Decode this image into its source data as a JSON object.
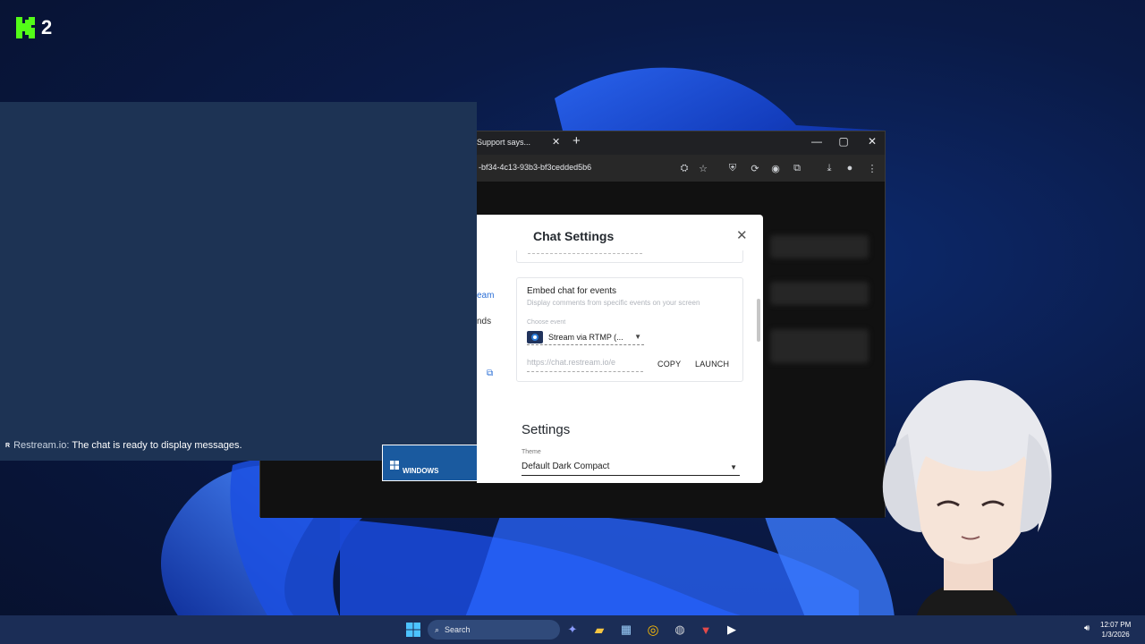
{
  "logo": {
    "mark": "K",
    "number": "2"
  },
  "chat_overlay": {
    "sender": "Restream.io:",
    "message": "The chat is ready to display messages."
  },
  "browser": {
    "tab_title": "Support says...",
    "tab_close": "✕",
    "new_tab": "+",
    "url": "-bf34-4c13-93b3-bf3cedded5b6",
    "window_buttons": {
      "minimize": "—",
      "maximize": "▢",
      "close": "✕"
    }
  },
  "modal": {
    "title": "Chat Settings",
    "close": "✕",
    "side_links": [
      "eam",
      "nds"
    ],
    "embed_card": {
      "title": "Embed chat for events",
      "subtitle": "Display comments from specific events on your screen",
      "choose_label": "Choose event",
      "selected_event": "Stream via RTMP (...",
      "url_value": "https://chat.restream.io/e",
      "copy_label": "COPY",
      "launch_label": "LAUNCH"
    },
    "settings_heading": "Settings",
    "theme_label": "Theme",
    "theme_value": "Default Dark Compact"
  },
  "windows_button": {
    "label": "WINDOWS"
  },
  "taskbar": {
    "search_label": "Search",
    "time": "12:07 PM",
    "date": "1/3/2026"
  },
  "colors": {
    "accent_blue": "#1a5a9f",
    "overlay_bg": "#1d3354",
    "taskbar_bg": "#1b2d56",
    "logo_green": "#53fc18"
  }
}
